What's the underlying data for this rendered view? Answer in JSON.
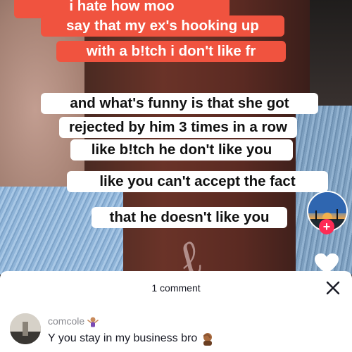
{
  "captions": {
    "line1": "i hate how moo",
    "line2": "say that my ex's hooking up",
    "line3": "with a b!tch i don't like fr",
    "line4": "and what's funny is that she got",
    "line5": "rejected by him 3 times in a row",
    "line6": "like b!tch he don't like you",
    "line7": "like you can't accept the fact",
    "line8": "that he doesn't like you"
  },
  "comments_panel": {
    "title": "1 comment",
    "comments": [
      {
        "username": "comcole",
        "text": "Y you stay in my business bro"
      }
    ]
  },
  "icons": [
    "shrug-emoji-icon",
    "plus-icon",
    "heart-icon",
    "close-icon",
    "facepalm-emoji-icon"
  ],
  "colors": {
    "caption_red": "#f0533f",
    "follow_pink": "#fe2c55"
  }
}
